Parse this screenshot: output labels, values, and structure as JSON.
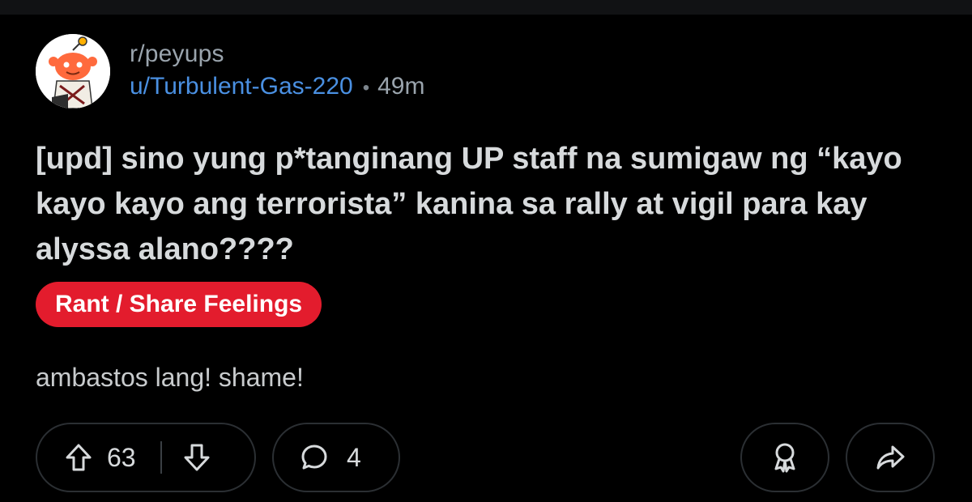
{
  "post": {
    "subreddit": "r/peyups",
    "author": "u/Turbulent-Gas-220",
    "separator": "•",
    "age": "49m",
    "title": "[upd] sino yung p*tanginang UP staff na sumigaw ng “kayo kayo kayo ang terrorista” kanina sa rally at vigil para kay alyssa alano????",
    "flair": "Rant / Share Feelings",
    "body": "ambastos lang! shame!"
  },
  "actions": {
    "upvotes": "63",
    "comments": "4"
  },
  "icons": {
    "upvote": "arrow-up-icon",
    "downvote": "arrow-down-icon",
    "comment": "comment-bubble-icon",
    "award": "award-icon",
    "share": "share-icon"
  },
  "colors": {
    "background": "#000000",
    "flair": "#e31c2d",
    "author_link": "#4a90e2",
    "muted": "#9aa4ad"
  }
}
